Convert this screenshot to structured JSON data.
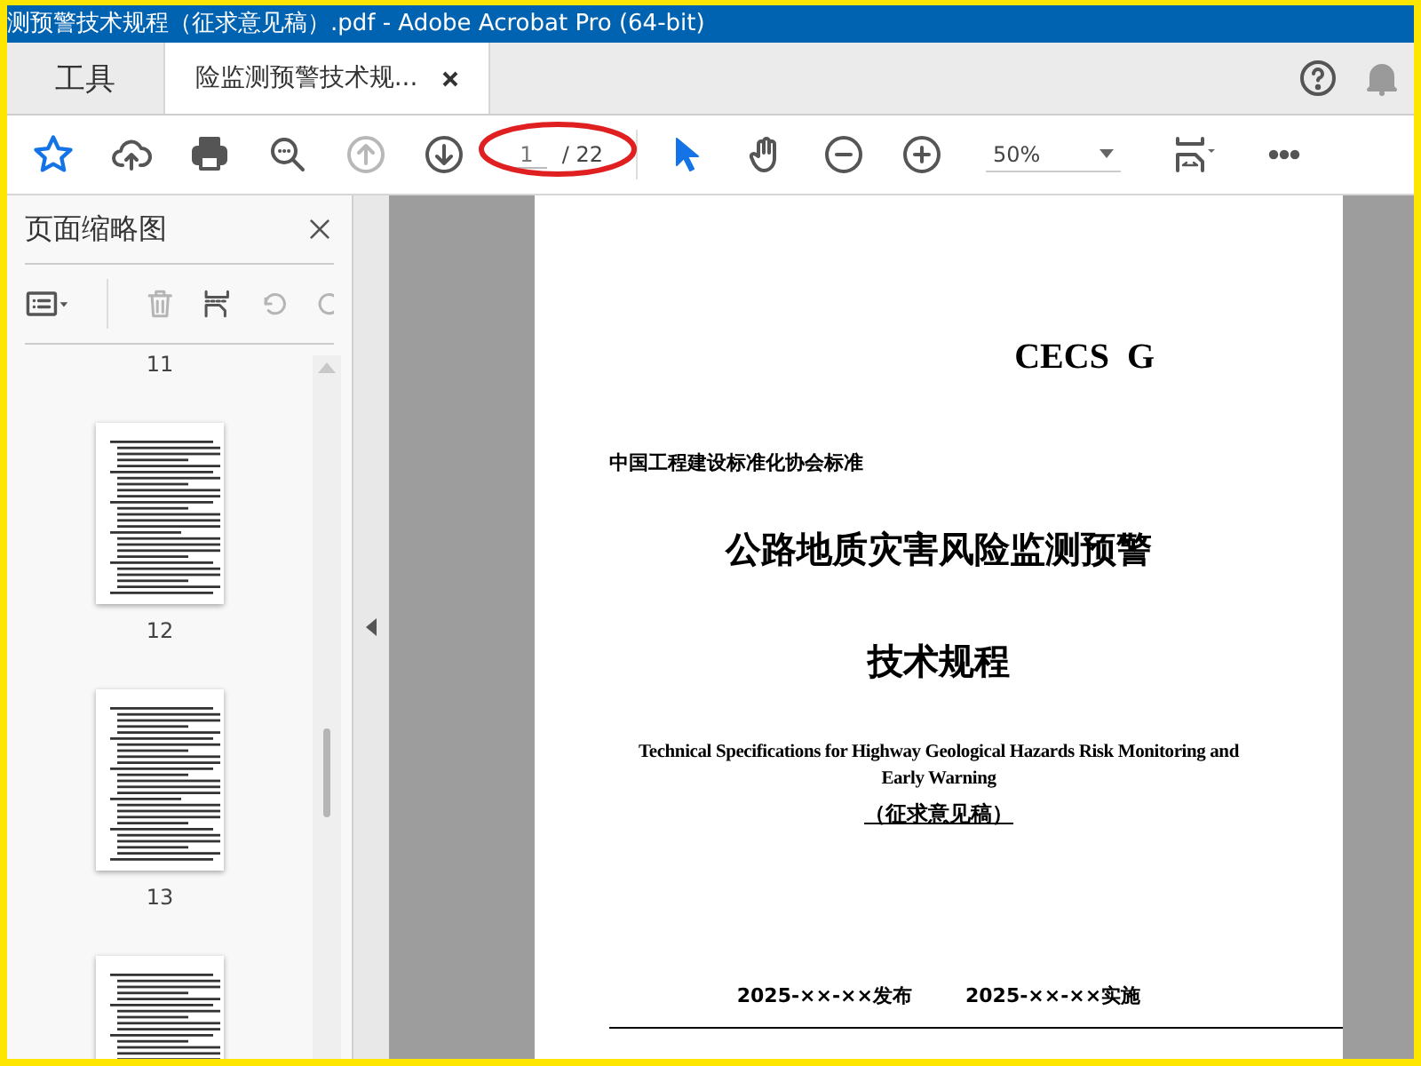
{
  "window": {
    "title": "测预警技术规程（征求意见稿）.pdf - Adobe Acrobat Pro (64-bit)"
  },
  "tabs": [
    {
      "label": "工具",
      "selected": false
    },
    {
      "label": "险监测预警技术规...",
      "selected": true
    }
  ],
  "toolbar": {
    "page_current": "1",
    "page_total": "/ 22",
    "zoom": "50%"
  },
  "thumbnails_panel": {
    "title": "页面缩略图",
    "page_labels": [
      "11",
      "12",
      "13"
    ]
  },
  "document": {
    "code": "CECS  G",
    "publisher_line": "中国工程建设标准化协会标准",
    "title_line_1": "公路地质灾害风险监测预警",
    "title_line_2": "技术规程",
    "english_title": "Technical Specifications for Highway Geological Hazards Risk Monitoring and Early Warning",
    "draft_note": "（征求意见稿）",
    "issue_date": "2025-××-××发布",
    "effective_date": "2025-××-××实施"
  }
}
